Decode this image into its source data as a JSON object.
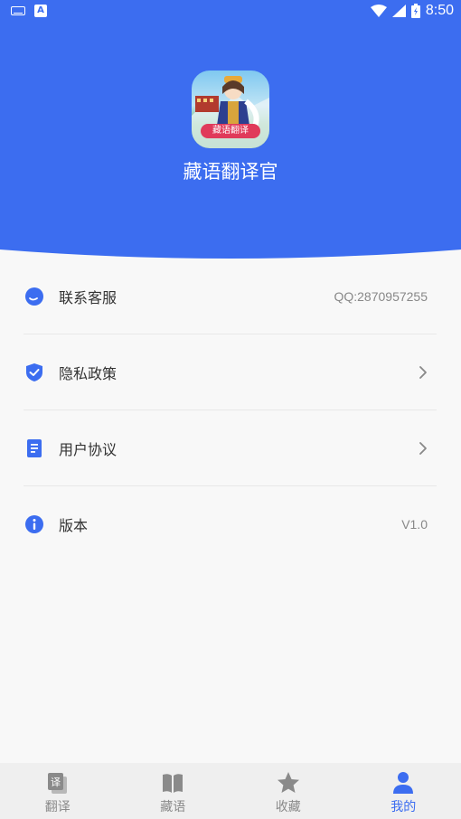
{
  "status_bar": {
    "time": "8:50"
  },
  "app": {
    "title": "藏语翻译官",
    "logo_text": "藏语翻译"
  },
  "menu": {
    "items": [
      {
        "label": "联系客服",
        "value": "QQ:2870957255",
        "icon": "chat-bubble-icon"
      },
      {
        "label": "隐私政策",
        "value": "",
        "icon": "shield-icon"
      },
      {
        "label": "用户协议",
        "value": "",
        "icon": "document-icon"
      },
      {
        "label": "版本",
        "value": "V1.0",
        "icon": "info-icon"
      }
    ]
  },
  "bottom_nav": {
    "items": [
      {
        "label": "翻译",
        "icon": "translate-icon",
        "active": false
      },
      {
        "label": "藏语",
        "icon": "book-icon",
        "active": false
      },
      {
        "label": "收藏",
        "icon": "star-icon",
        "active": false
      },
      {
        "label": "我的",
        "icon": "user-icon",
        "active": true
      }
    ]
  },
  "colors": {
    "primary": "#3c6df0",
    "background": "#f8f8f8",
    "nav_inactive": "#8a8a8a"
  }
}
